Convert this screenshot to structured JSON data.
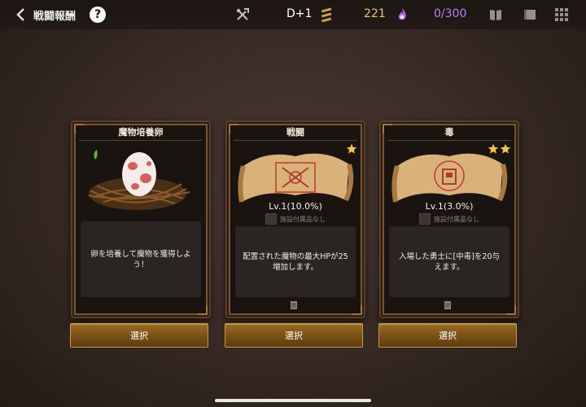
{
  "header": {
    "title": "戦闘報酬",
    "day": "D+1",
    "gold": "221",
    "monster_count": "0/300"
  },
  "cards": [
    {
      "title": "魔物培養卵",
      "description": "卵を培養して魔物を獲得しよう！",
      "button": "選択"
    },
    {
      "title": "戦闘",
      "level": "Lv.1(10.0%)",
      "facility": "施設付属品なし",
      "description": "配置された魔物の最大HPが25増加します。",
      "stars": 1,
      "button": "選択"
    },
    {
      "title": "毒",
      "level": "Lv.1(3.0%)",
      "facility": "施設付属品なし",
      "description": "入場した勇士に[中毒]を20与えます。",
      "stars": 2,
      "button": "選択"
    }
  ],
  "colors": {
    "gold": "#e7c77a",
    "count": "#b983f0",
    "button": "#7b5216",
    "frame": "#7a5533"
  }
}
